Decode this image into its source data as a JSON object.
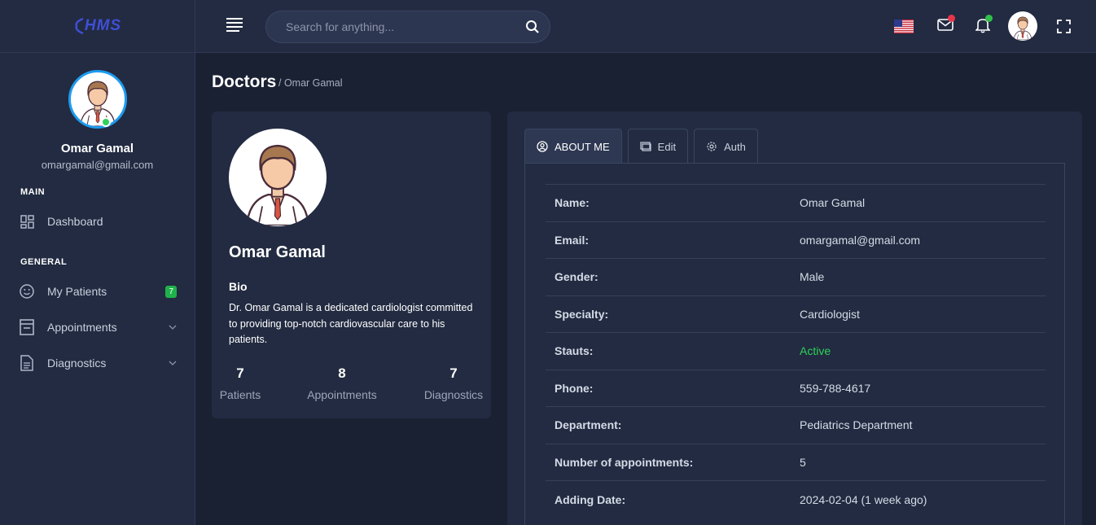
{
  "app": {
    "logo_text": "HMS"
  },
  "sidebar": {
    "user": {
      "name": "Omar Gamal",
      "email": "omargamal@gmail.com"
    },
    "sections": [
      {
        "label": "MAIN"
      },
      {
        "label": "GENERAL"
      }
    ],
    "items": [
      {
        "label": "Dashboard",
        "icon": "dashboard-icon"
      },
      {
        "label": "My Patients",
        "icon": "smiley-icon",
        "badge": "7"
      },
      {
        "label": "Appointments",
        "icon": "calendar-icon"
      },
      {
        "label": "Diagnostics",
        "icon": "document-icon"
      }
    ]
  },
  "topbar": {
    "search_placeholder": "Search for anything...",
    "icons": [
      "menu-icon",
      "search-icon",
      "us-flag-icon",
      "mail-icon",
      "bell-icon",
      "avatar",
      "fullscreen-icon"
    ],
    "colors": {
      "mail_dot": "#e8354a",
      "bell_dot": "#2fbf4a"
    }
  },
  "page": {
    "title": "Doctors",
    "breadcrumb": "/ Omar Gamal"
  },
  "profile_card": {
    "name": "Omar Gamal",
    "bio_title": "Bio",
    "bio": "Dr. Omar Gamal is a dedicated cardiologist committed to providing top-notch cardiovascular care to his patients.",
    "stats": [
      {
        "value": "7",
        "label": "Patients"
      },
      {
        "value": "8",
        "label": "Appointments"
      },
      {
        "value": "7",
        "label": "Diagnostics"
      }
    ]
  },
  "details": {
    "tabs": [
      {
        "label": "ABOUT ME",
        "icon": "user-circle-icon"
      },
      {
        "label": "Edit",
        "icon": "edit-icon"
      },
      {
        "label": "Auth",
        "icon": "gear-icon"
      }
    ],
    "rows": [
      {
        "key": "Name:",
        "value": "Omar Gamal"
      },
      {
        "key": "Email:",
        "value": "omargamal@gmail.com"
      },
      {
        "key": "Gender:",
        "value": "Male"
      },
      {
        "key": "Specialty:",
        "value": "Cardiologist"
      },
      {
        "key": "Stauts:",
        "value": "Active"
      },
      {
        "key": "Phone:",
        "value": "559-788-4617"
      },
      {
        "key": "Department:",
        "value": "Pediatrics Department"
      },
      {
        "key": "Number of appointments:",
        "value": "5"
      },
      {
        "key": "Adding Date:",
        "value": "2024-02-04 (1 week ago)"
      }
    ],
    "active_color": "#2ed158"
  }
}
